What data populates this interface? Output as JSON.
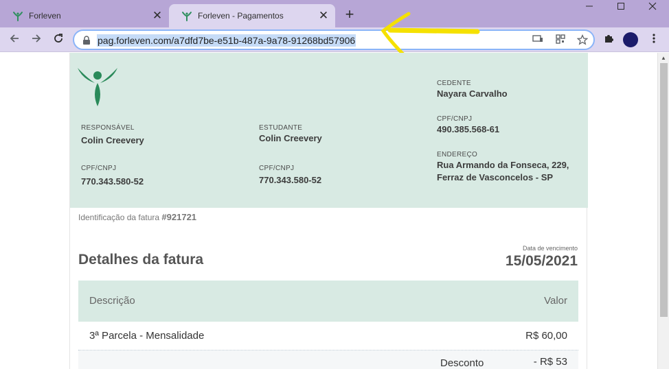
{
  "browser": {
    "tabs": [
      {
        "title": "Forleven",
        "close": "✕"
      },
      {
        "title": "Forleven - Pagamentos",
        "close": "✕"
      }
    ],
    "new_tab": "+",
    "url": "pag.forleven.com/a7dfd7be-e51b-487a-9a78-91268bd57906",
    "accent_color": "#b7a6d6",
    "annotation_color": "#f5e100"
  },
  "header": {
    "responsavel": {
      "label": "RESPONSÁVEL",
      "name": "Colin Creevery",
      "doc_label": "CPF/CNPJ",
      "doc": "770.343.580-52"
    },
    "estudante": {
      "label": "ESTUDANTE",
      "name": "Colin Creevery",
      "doc_label": "CPF/CNPJ",
      "doc": "770.343.580-52"
    },
    "cedente": {
      "label": "CEDENTE",
      "name": "Nayara Carvalho",
      "doc_label": "CPF/CNPJ",
      "doc": "490.385.568-61",
      "address_label": "ENDEREÇO",
      "address_line1": "Rua Armando da Fonseca, 229,",
      "address_line2": "Ferraz de Vasconcelos - SP"
    }
  },
  "invoice": {
    "id_label": "Identificação da fatura",
    "id": "#921721",
    "title": "Detalhes da fatura",
    "due_label": "Data de vencimento",
    "due_date": "15/05/2021",
    "table": {
      "col_desc": "Descrição",
      "col_val": "Valor",
      "rows": [
        {
          "desc": "3ª Parcela - Mensalidade",
          "value": "R$ 60,00"
        }
      ],
      "discount_label": "Desconto",
      "discount_value": "- R$ 53"
    }
  },
  "icons": {
    "back": "arrow-left-icon",
    "forward": "arrow-right-icon",
    "reload": "reload-icon",
    "lock": "lock-icon",
    "cast": "cast-icon",
    "qr": "qr-code-icon",
    "star": "star-icon",
    "extensions": "puzzle-icon",
    "menu": "kebab-menu-icon"
  }
}
